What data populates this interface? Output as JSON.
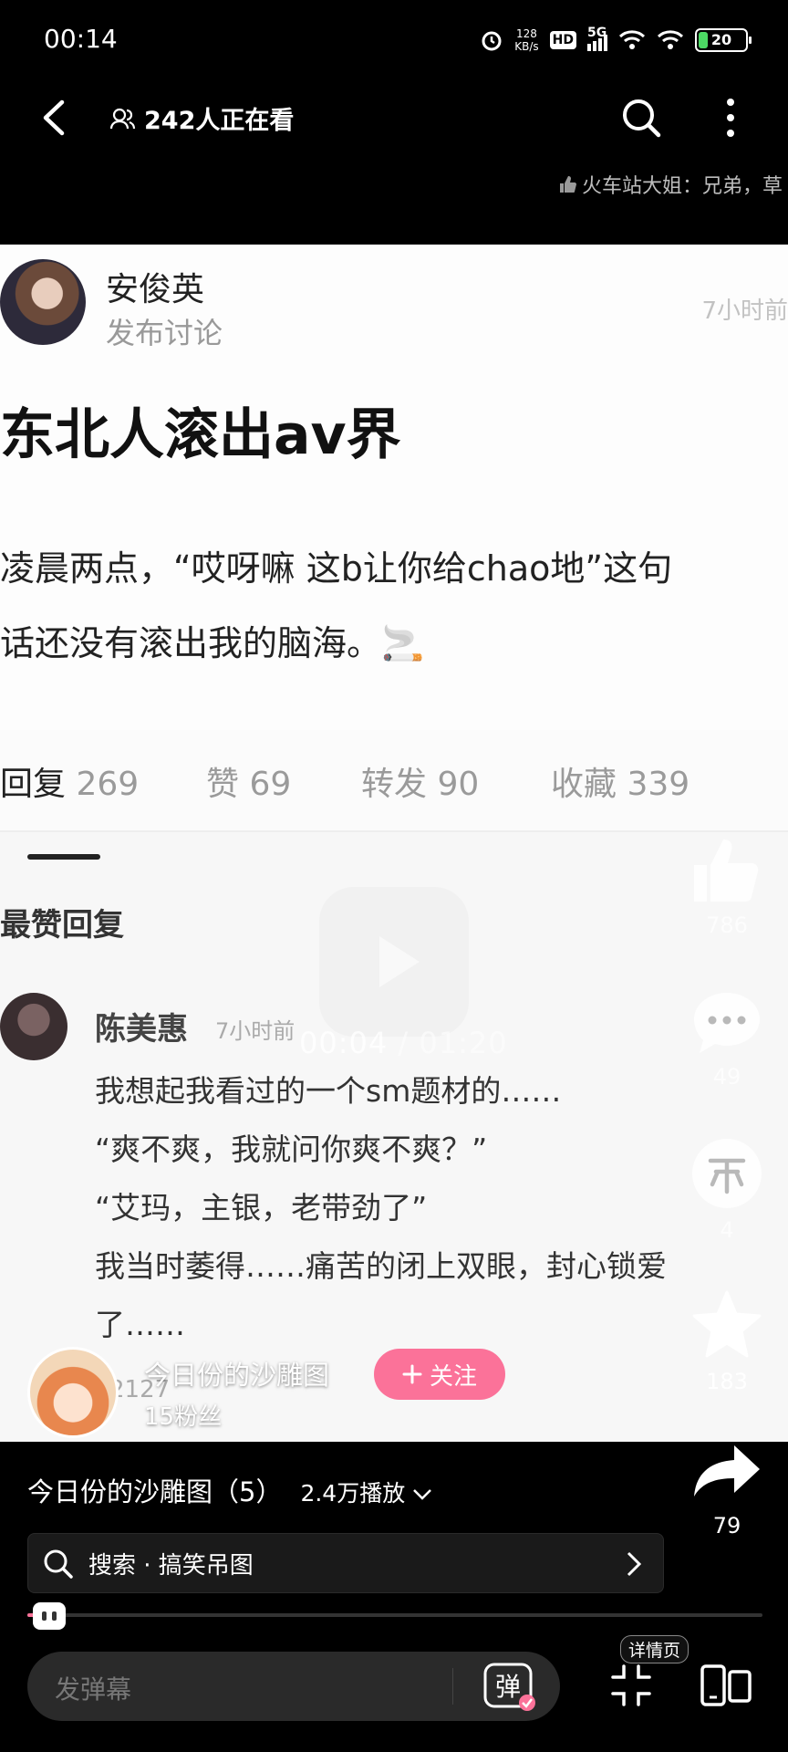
{
  "status_bar": {
    "time": "00:14",
    "net_speed_value": "128",
    "net_speed_unit": "KB/s",
    "hd": "HD",
    "network": "5G",
    "battery": "20",
    "battery_level": 0.2
  },
  "nav": {
    "viewers": "242人正在看"
  },
  "danmaku": {
    "scrolling_text": "火车站大姐：兄弟，草"
  },
  "post": {
    "author": "安俊英",
    "action": "发布讨论",
    "time": "7小时前",
    "title": "东北人滚出av界",
    "body_line1": "凌晨两点，“哎呀嘛 这b让你给chao地”这句",
    "body_line2": "话还没有滚出我的脑海。🚬",
    "tabs": [
      {
        "label": "回复",
        "count": "269"
      },
      {
        "label": "赞",
        "count": "69"
      },
      {
        "label": "转发",
        "count": "90"
      },
      {
        "label": "收藏",
        "count": "339"
      }
    ],
    "section_title": "最赞回复",
    "comment": {
      "author": "陈美惠",
      "time": "7小时前",
      "lines": [
        "我想起我看过的一个sm题材的……",
        "“爽不爽，我就问你爽不爽？”",
        "“艾玛，主银，老带劲了”",
        "我当时萎得……痛苦的闭上双眼，封心锁爱",
        "了……"
      ],
      "likes": "2127"
    }
  },
  "player": {
    "current_time": "00:04",
    "total_time": "01:20",
    "progress": 0.05
  },
  "side_actions": {
    "like_count": "786",
    "comment_count": "49",
    "coin_count": "4",
    "favorite_count": "183",
    "share_count": "79"
  },
  "uploader": {
    "name": "今日份的沙雕图",
    "fans": "15粉丝",
    "follow_label": "关注"
  },
  "video": {
    "title": "今日份的沙雕图（5）",
    "plays": "2.4万播放"
  },
  "search_bar": {
    "text": "搜索 · 搞笑吊图"
  },
  "bottom": {
    "danmaku_placeholder": "发弹幕",
    "danmaku_toggle": "弹",
    "detail_badge": "详情页"
  }
}
